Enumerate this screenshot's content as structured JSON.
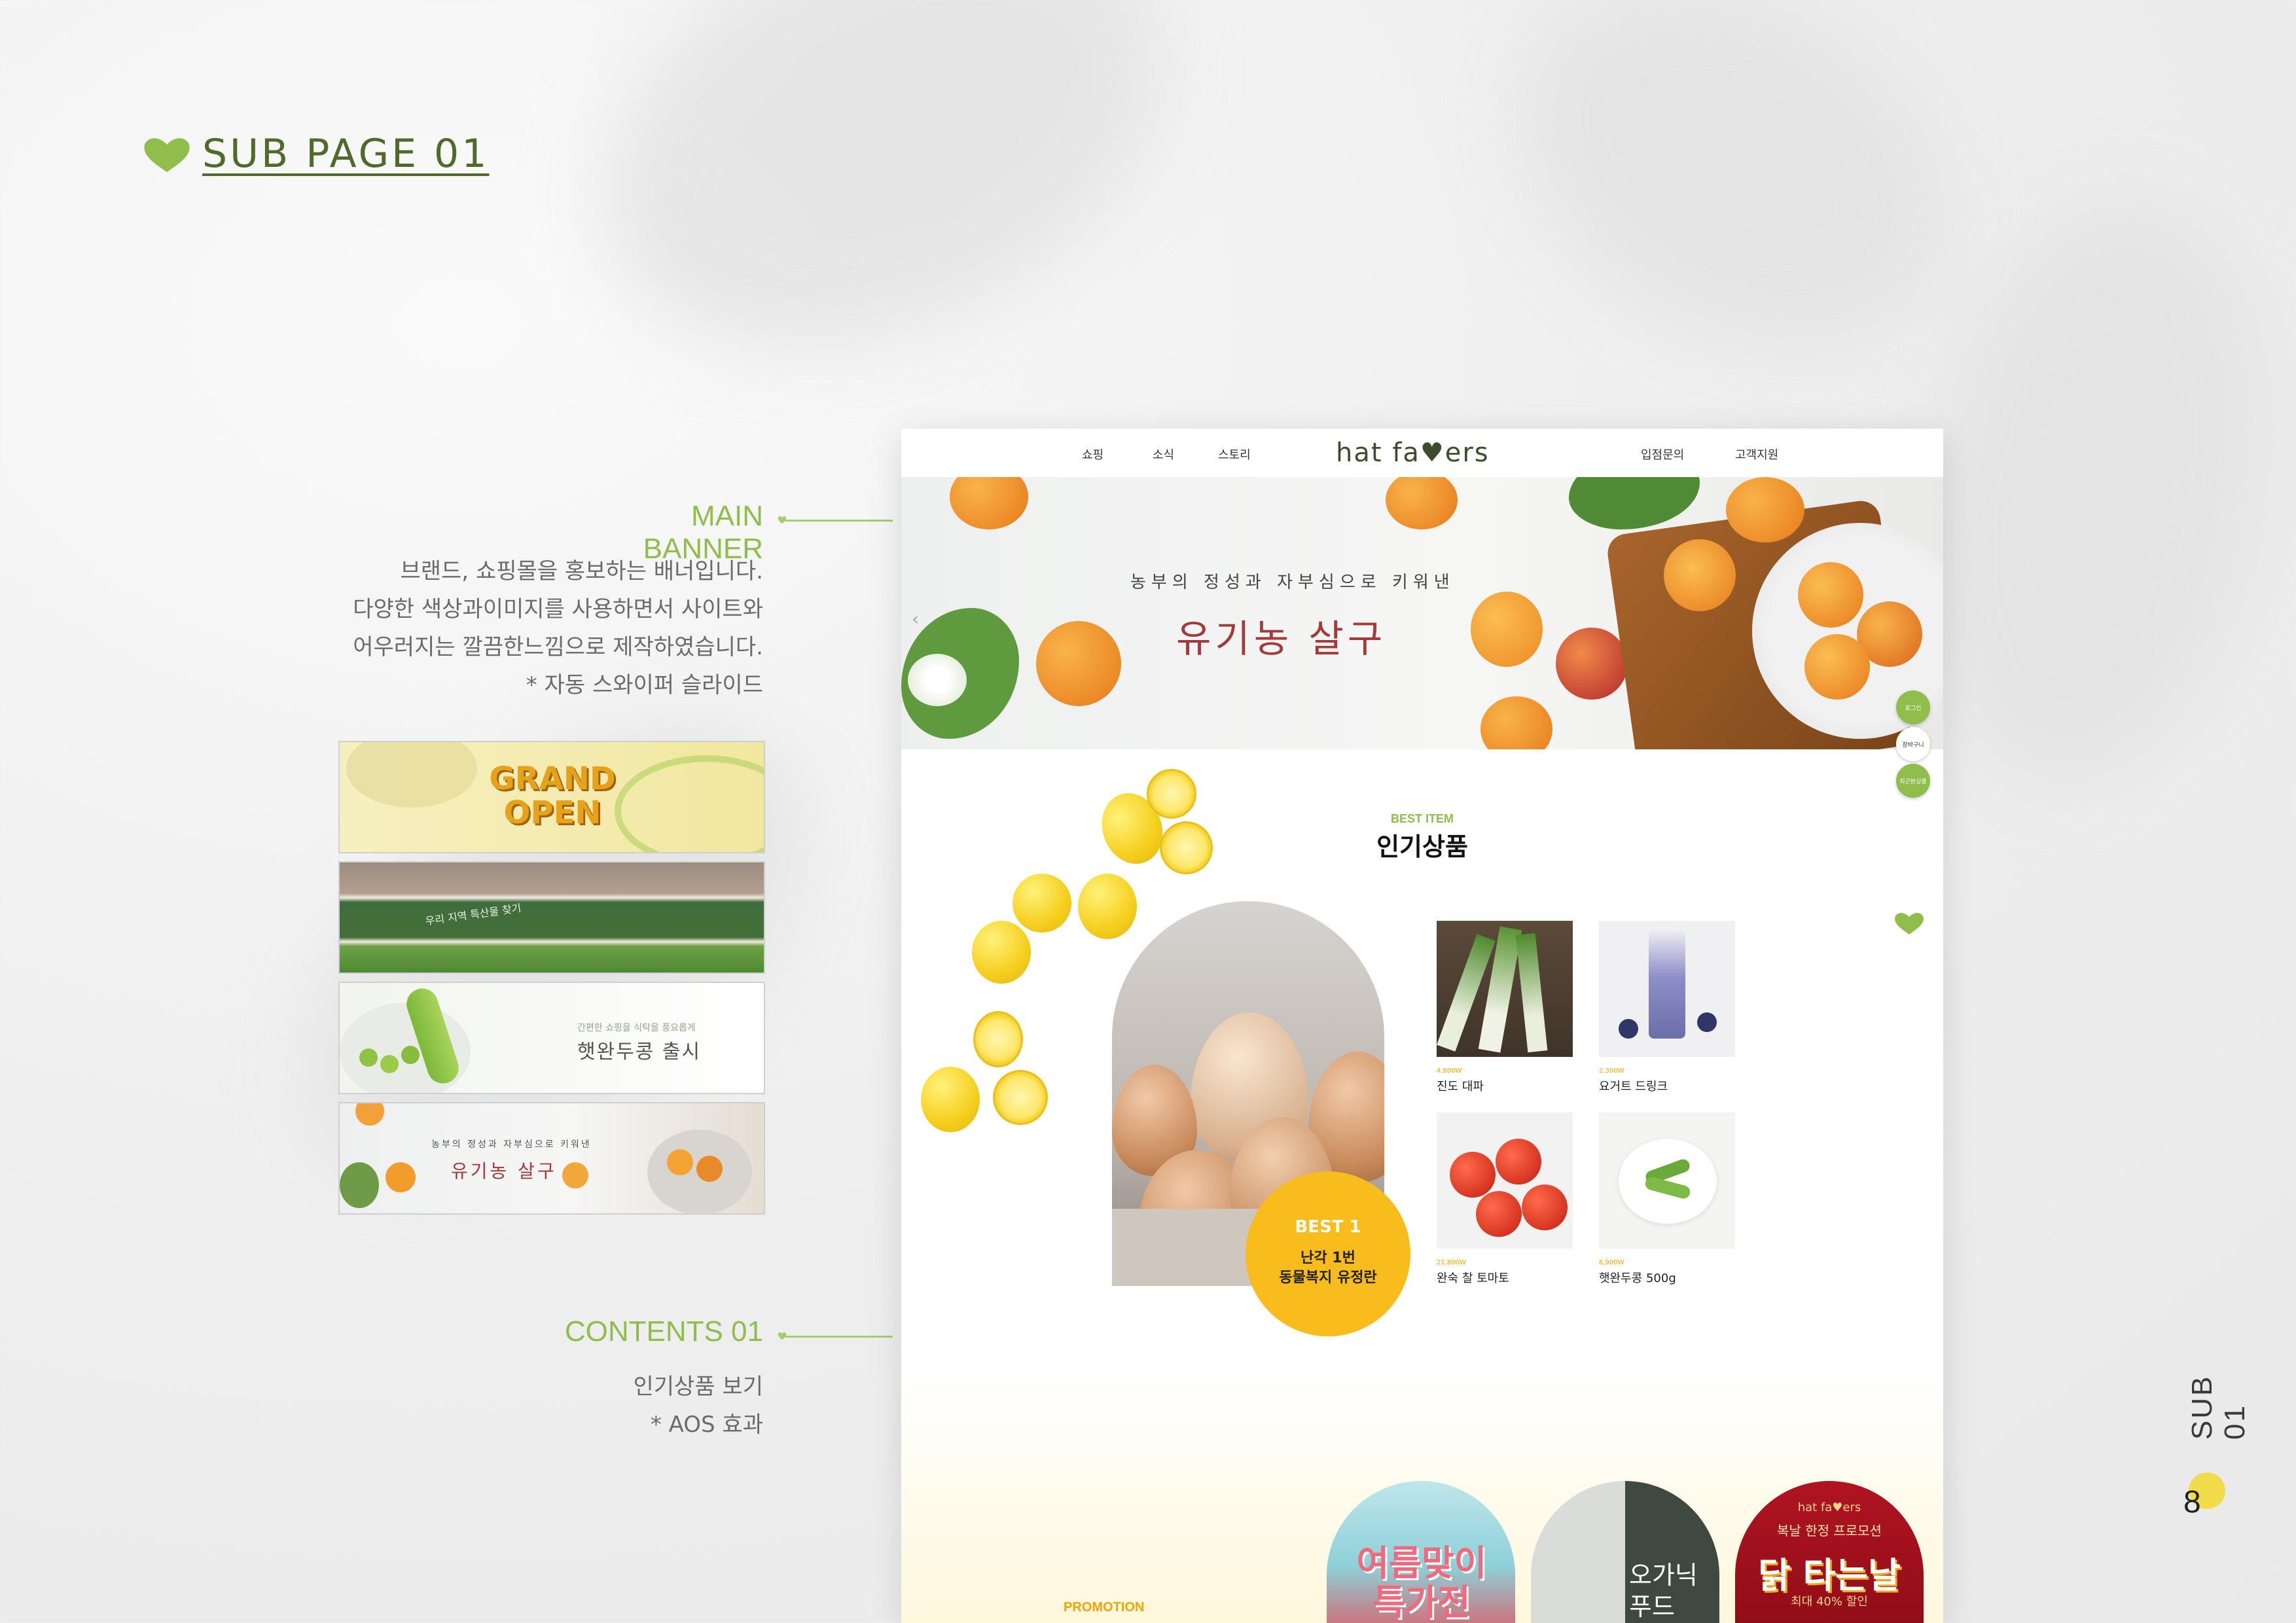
{
  "colors": {
    "accent_green": "#8fbe4c",
    "title_red": "#a23a3a",
    "badge_yellow": "#f8bc1c"
  },
  "heading": {
    "icon": "heart-leaf-icon",
    "text": "SUB PAGE 01"
  },
  "main_banner": {
    "title": "MAIN BANNER",
    "lines": [
      "브랜드, 쇼핑몰을 홍보하는 배너입니다.",
      "다양한 색상과이미지를 사용하면서 사이트와",
      "어우러지는 깔끔한느낌으로 제작하였습니다.",
      "* 자동 스와이퍼 슬라이드"
    ]
  },
  "thumbnails": {
    "t1_title": "GRAND OPEN",
    "t2_sub": "우리 지역 특산물 찾기",
    "t3_sub": "간편한 쇼핑을 식탁을 풍요롭게",
    "t3_title": "햇완두콩 출시",
    "t4_sub": "농부의 정성과 자부심으로 키워낸",
    "t4_title": "유기농 살구"
  },
  "contents_01": {
    "title": "CONTENTS 01",
    "lines": [
      "인기상품 보기",
      "* AOS 효과"
    ]
  },
  "mock": {
    "nav": {
      "shop": "쇼핑",
      "news": "소식",
      "story": "스토리",
      "logo": "hat fa♥ers",
      "partner": "입점문의",
      "support": "고객지원"
    },
    "hero": {
      "sub": "농부의 정성과 자부심으로 키워낸",
      "title": "유기농 살구"
    },
    "side_buttons": {
      "login": "로그인",
      "cart": "장바구니",
      "recent": "최근본상품"
    },
    "best": {
      "label": "BEST ITEM",
      "title": "인기상품"
    },
    "badge": {
      "rank": "BEST 1",
      "line1": "난각 1번",
      "line2": "동물복지 유정란"
    },
    "products": [
      {
        "price": "4,800W",
        "name": "진도 대파"
      },
      {
        "price": "2,300W",
        "name": "요거트 드링크"
      },
      {
        "price": "21,800W",
        "name": "완숙 찰 토마토"
      },
      {
        "price": "6,900W",
        "name": "햇완두콩 500g"
      }
    ],
    "promo": {
      "label": "PROMOTION",
      "card1": "여름맞이 특가전",
      "card2": "오가닉 푸드",
      "card3_brand": "hat fa♥ers",
      "card3_sub": "복날 한정 프로모션",
      "card3_title": "닭 타는날",
      "card3_discount": "최대 40% 할인"
    }
  },
  "side_label": "SUB 01",
  "page_number": "8"
}
